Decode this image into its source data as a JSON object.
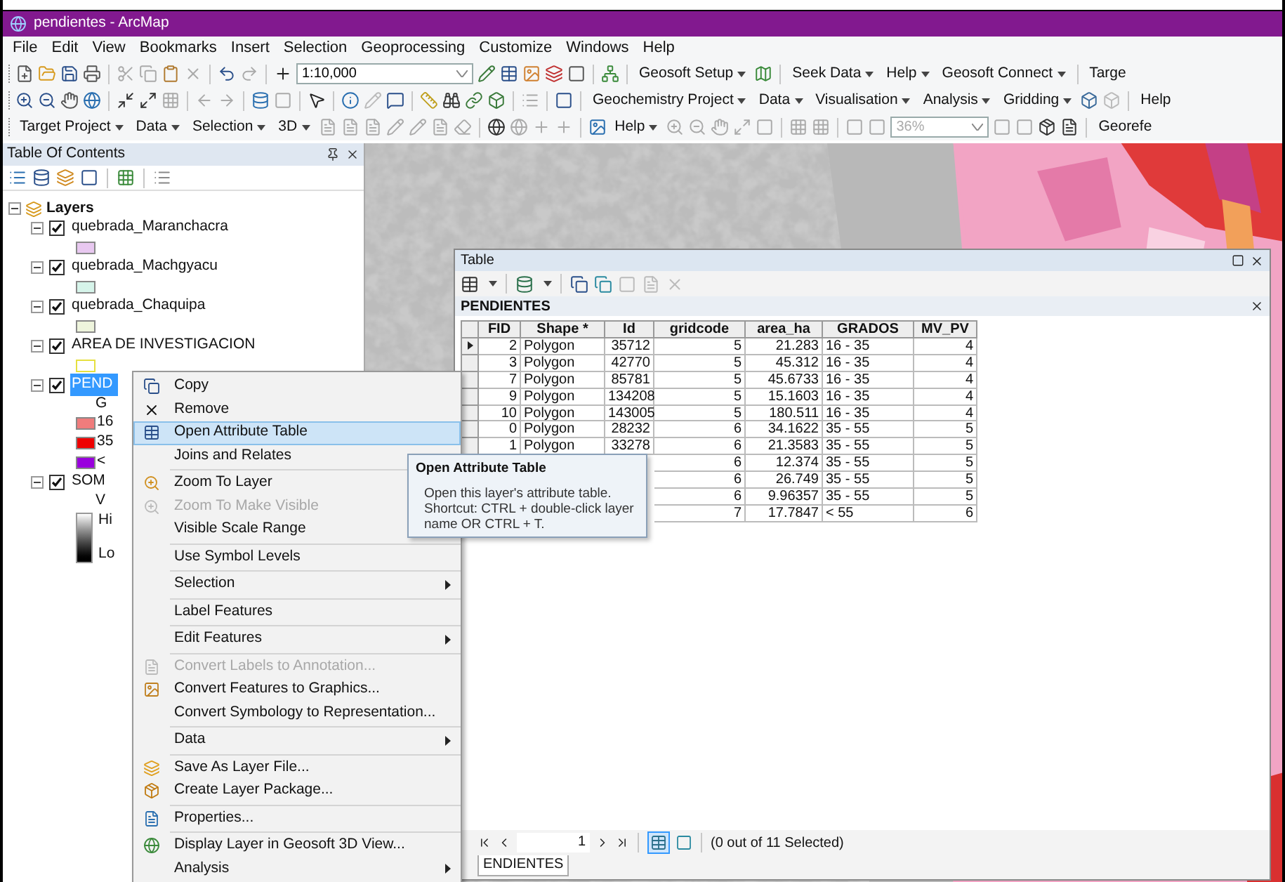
{
  "window": {
    "title": "pendientes - ArcMap"
  },
  "menu_bar": [
    "File",
    "Edit",
    "View",
    "Bookmarks",
    "Insert",
    "Selection",
    "Geoprocessing",
    "Customize",
    "Windows",
    "Help"
  ],
  "toolbars": [
    [
      {
        "kind": "combo",
        "value": "1:10,000",
        "disabled": false
      },
      {
        "kind": "menu",
        "label": "Geosoft Setup"
      },
      {
        "kind": "menu",
        "label": "Seek Data"
      },
      {
        "kind": "menu",
        "label": "Help"
      },
      {
        "kind": "menu",
        "label": "Geosoft Connect"
      },
      {
        "kind": "text",
        "label": "Targe"
      }
    ],
    [
      {
        "kind": "menu",
        "label": "Geochemistry Project"
      },
      {
        "kind": "menu",
        "label": "Data"
      },
      {
        "kind": "menu",
        "label": "Visualisation"
      },
      {
        "kind": "menu",
        "label": "Analysis"
      },
      {
        "kind": "menu",
        "label": "Gridding"
      },
      {
        "kind": "text",
        "label": "Help"
      }
    ],
    [
      {
        "kind": "menu",
        "label": "Target Project"
      },
      {
        "kind": "menu",
        "label": "Data"
      },
      {
        "kind": "menu",
        "label": "Selection"
      },
      {
        "kind": "menu",
        "label": "3D"
      },
      {
        "kind": "menu",
        "label": "Help"
      },
      {
        "kind": "combo",
        "value": "36%",
        "disabled": true
      },
      {
        "kind": "text",
        "label": "Georefe"
      }
    ]
  ],
  "toc": {
    "title": "Table Of Contents",
    "root": {
      "name": "Layers",
      "expanded": true,
      "children": [
        {
          "name": "quebrada_Maranchacra",
          "checked": true,
          "expanded": true,
          "selected": false,
          "legend": [
            {
              "kind": "swatch",
              "color": "#e8c8f0"
            }
          ]
        },
        {
          "name": "quebrada_Machgyacu",
          "checked": true,
          "expanded": true,
          "selected": false,
          "legend": [
            {
              "kind": "swatch",
              "color": "#d6f4ea"
            }
          ]
        },
        {
          "name": "quebrada_Chaquipa",
          "checked": true,
          "expanded": true,
          "selected": false,
          "legend": [
            {
              "kind": "swatch",
              "color": "#eef4dc"
            }
          ]
        },
        {
          "name": "AREA DE INVESTIGACION",
          "checked": true,
          "expanded": true,
          "selected": false,
          "legend": [
            {
              "kind": "outline-swatch",
              "color": "#e6e040"
            }
          ]
        },
        {
          "name": "PEND",
          "checked": true,
          "expanded": true,
          "selected": true,
          "legend": [
            {
              "kind": "heading",
              "label": "G"
            },
            {
              "kind": "swatch",
              "color": "#f07c7c",
              "label": "16"
            },
            {
              "kind": "swatch",
              "color": "#ee0000",
              "label": "35"
            },
            {
              "kind": "swatch",
              "color": "#9900dd",
              "label": "<"
            }
          ]
        },
        {
          "name": "SOM",
          "checked": true,
          "expanded": true,
          "selected": false,
          "legend": [
            {
              "kind": "heading",
              "label": "V"
            },
            {
              "kind": "ramp",
              "high": "Hi",
              "low": "Lo"
            }
          ]
        }
      ]
    }
  },
  "table_window": {
    "title": "Table",
    "layer": "PENDIENTES",
    "columns": [
      "FID",
      "Shape *",
      "Id",
      "gridcode",
      "area_ha",
      "GRADOS",
      "MV_PV"
    ],
    "rows": [
      {
        "current": true,
        "cells": [
          "2",
          "Polygon",
          "35712",
          "5",
          "21.283",
          "16 - 35",
          "4"
        ]
      },
      {
        "current": false,
        "cells": [
          "3",
          "Polygon",
          "42770",
          "5",
          "45.312",
          "16 - 35",
          "4"
        ]
      },
      {
        "current": false,
        "cells": [
          "7",
          "Polygon",
          "85781",
          "5",
          "45.6733",
          "16 - 35",
          "4"
        ]
      },
      {
        "current": false,
        "cells": [
          "9",
          "Polygon",
          "134208",
          "5",
          "15.1603",
          "16 - 35",
          "4"
        ]
      },
      {
        "current": false,
        "cells": [
          "10",
          "Polygon",
          "143005",
          "5",
          "180.511",
          "16 - 35",
          "4"
        ]
      },
      {
        "current": false,
        "cells": [
          "0",
          "Polygon",
          "28232",
          "6",
          "34.1622",
          "35 - 55",
          "5"
        ]
      },
      {
        "current": false,
        "cells": [
          "1",
          "Polygon",
          "33278",
          "6",
          "21.3583",
          "35 - 55",
          "5"
        ]
      },
      {
        "cells": [
          null,
          null,
          null,
          "6",
          "12.374",
          "35 - 55",
          "5"
        ]
      },
      {
        "cells": [
          null,
          null,
          null,
          "6",
          "26.749",
          "35 - 55",
          "5"
        ]
      },
      {
        "cells": [
          null,
          null,
          null,
          "6",
          "9.96357",
          "35 - 55",
          "5"
        ]
      },
      {
        "cells": [
          null,
          null,
          null,
          "7",
          "17.7847",
          "< 55",
          "6"
        ]
      }
    ],
    "record": "1",
    "selection_status": "(0 out of 11 Selected)",
    "tab": "ENDIENTES"
  },
  "context_menu": [
    [
      {
        "label": "Copy",
        "selected": false,
        "disabled": false,
        "submenu": false
      },
      {
        "label": "Remove",
        "selected": false,
        "disabled": false,
        "submenu": false
      },
      {
        "label": "Open Attribute Table",
        "selected": true,
        "disabled": false,
        "submenu": false
      },
      {
        "label": "Joins and Relates",
        "selected": false,
        "disabled": false,
        "submenu": false
      }
    ],
    [
      {
        "label": "Zoom To Layer",
        "selected": false,
        "disabled": false
      },
      {
        "label": "Zoom To Make Visible",
        "selected": false,
        "disabled": true
      },
      {
        "label": "Visible Scale Range",
        "selected": false,
        "disabled": false
      }
    ],
    [
      {
        "label": "Use Symbol Levels",
        "selected": false,
        "disabled": false,
        "submenu": false
      }
    ],
    [
      {
        "label": "Selection",
        "selected": false,
        "disabled": false,
        "submenu": true
      }
    ],
    [
      {
        "label": "Label Features",
        "selected": false,
        "disabled": false,
        "submenu": false
      }
    ],
    [
      {
        "label": "Edit Features",
        "selected": false,
        "disabled": false,
        "submenu": true
      }
    ],
    [
      {
        "label": "Convert Labels to Annotation...",
        "selected": false,
        "disabled": true,
        "submenu": false
      },
      {
        "label": "Convert Features to Graphics...",
        "selected": false,
        "disabled": false,
        "submenu": false
      },
      {
        "label": "Convert Symbology to Representation...",
        "selected": false,
        "disabled": false,
        "submenu": false
      }
    ],
    [
      {
        "label": "Data",
        "selected": false,
        "disabled": false,
        "submenu": true
      }
    ],
    [
      {
        "label": "Save As Layer File...",
        "selected": false,
        "disabled": false,
        "submenu": false
      },
      {
        "label": "Create Layer Package...",
        "selected": false,
        "disabled": false,
        "submenu": false
      }
    ],
    [
      {
        "label": "Properties...",
        "selected": false,
        "disabled": false,
        "submenu": false
      }
    ],
    [
      {
        "label": "Display Layer in Geosoft 3D View...",
        "selected": false,
        "disabled": false,
        "submenu": false
      },
      {
        "label": "Analysis",
        "selected": false,
        "disabled": false,
        "submenu": true
      }
    ]
  ],
  "tooltip": {
    "title": "Open Attribute Table",
    "text": "Open this layer's attribute table. Shortcut: CTRL + double-click layer name OR CTRL + T."
  }
}
